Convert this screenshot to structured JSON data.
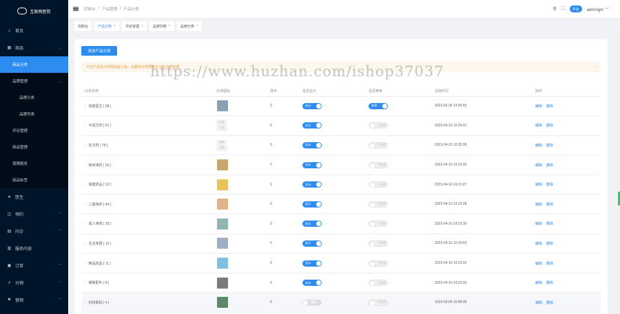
{
  "app": {
    "logo_text": "互联网医院"
  },
  "sidebar": {
    "items": [
      {
        "label": "首页",
        "icon": "home-icon"
      },
      {
        "label": "商品",
        "icon": "shop-icon",
        "expanded": true
      },
      {
        "label": "医生",
        "icon": "user-icon"
      },
      {
        "label": "预约",
        "icon": "calendar-icon"
      },
      {
        "label": "问诊",
        "icon": "chat-icon"
      },
      {
        "label": "服务内容",
        "icon": "service-icon"
      },
      {
        "label": "订单",
        "icon": "order-icon"
      },
      {
        "label": "分销",
        "icon": "share-icon"
      },
      {
        "label": "营销",
        "icon": "flag-icon"
      }
    ],
    "sub": {
      "product_category": "商品分类",
      "brand_mgmt": "品牌管理",
      "brand_category": "品牌分类",
      "brand_list": "品牌列表",
      "review_mgmt": "评论管理",
      "product_mgmt": "商品管理",
      "guarantee": "保障服务",
      "product_tags": "商品标签"
    }
  },
  "header": {
    "breadcrumb": [
      "控制台",
      "/",
      "产品管理",
      "/",
      "产品分类"
    ],
    "platform_badge": "平台",
    "username": "admingm"
  },
  "tabs": [
    {
      "label": "控制台",
      "closable": false,
      "active": false
    },
    {
      "label": "产品分类",
      "closable": true,
      "active": true
    },
    {
      "label": "评论管理",
      "closable": true,
      "active": false
    },
    {
      "label": "品牌列表",
      "closable": true,
      "active": false
    },
    {
      "label": "品牌分类",
      "closable": true,
      "active": false
    }
  ],
  "page": {
    "add_button": "添加产品分类",
    "alert_text": "平台产品的分类层级是三级，设置的分类层级可以在分类管理",
    "watermark": "https://www.huzhan.com/ishop37037",
    "columns": [
      "分类名称",
      "分类图标",
      "排序",
      "是否显示",
      "是否推荐",
      "创建时间",
      "操作"
    ],
    "rows": [
      {
        "name": "家庭医生 [ 88 ]",
        "icon_color": "#8aa0b5",
        "placeholder": false,
        "sort": "0",
        "show": "显示",
        "show_on": true,
        "rec": "推荐",
        "rec_on": true,
        "time": "2023-06-28 14:06:55"
      },
      {
        "name": "中成方药 [ 81 ]",
        "icon_color": "#e5e5e5",
        "placeholder": true,
        "sort": "0",
        "show": "显示",
        "show_on": true,
        "rec": "不推荐",
        "rec_on": false,
        "time": "2023-04-19 16:34:01"
      },
      {
        "name": "处方药 [ 78 ]",
        "icon_color": "#e5e5e5",
        "placeholder": true,
        "sort": "0",
        "show": "显示",
        "show_on": true,
        "rec": "不推荐",
        "rec_on": false,
        "time": "2023-04-15 10:35:08"
      },
      {
        "name": "随身用药 [ 56 ]",
        "icon_color": "#c9a66b",
        "placeholder": false,
        "sort": "0",
        "show": "显示",
        "show_on": true,
        "rec": "不推荐",
        "rec_on": false,
        "time": "2023-04-10 14:23:26"
      },
      {
        "name": "保健药品 [ 52 ]",
        "icon_color": "#e8c35a",
        "placeholder": false,
        "sort": "0",
        "show": "显示",
        "show_on": true,
        "rec": "不推荐",
        "rec_on": false,
        "time": "2023-04-10 14:23:27"
      },
      {
        "name": "儿童用药 [ 44 ]",
        "icon_color": "#e2b48a",
        "placeholder": false,
        "sort": "0",
        "show": "显示",
        "show_on": true,
        "rec": "不推荐",
        "rec_on": false,
        "time": "2023-04-10 14:23:28"
      },
      {
        "name": "成人用药 [ 35 ]",
        "icon_color": "#8db7b0",
        "placeholder": false,
        "sort": "0",
        "show": "显示",
        "show_on": true,
        "rec": "不推荐",
        "rec_on": false,
        "time": "2023-04-10 14:23:30"
      },
      {
        "name": "生活家居 [ 15 ]",
        "icon_color": "#9fb0c4",
        "placeholder": false,
        "sort": "0",
        "show": "显示",
        "show_on": true,
        "rec": "不推荐",
        "rec_on": false,
        "time": "2023-04-15 10:30:55"
      },
      {
        "name": "精品药品 [ 11 ]",
        "icon_color": "#7fc0e0",
        "placeholder": false,
        "sort": "0",
        "show": "显示",
        "show_on": true,
        "rec": "不推荐",
        "rec_on": false,
        "time": "2023-04-10 14:23:32"
      },
      {
        "name": "眼睛配件 [ 8 ]",
        "icon_color": "#7a7a7a",
        "placeholder": false,
        "sort": "0",
        "show": "显示",
        "show_on": true,
        "rec": "不推荐",
        "rec_on": false,
        "time": "2023-04-10 14:23:33"
      },
      {
        "name": "科技数码 [ 4 ]",
        "icon_color": "#5a8a6a",
        "placeholder": false,
        "sort": "0",
        "show": "隐藏",
        "show_on": false,
        "rec": "不推荐",
        "rec_on": false,
        "time": "2023-03-04 15:08:09"
      }
    ],
    "op_edit": "编辑",
    "op_delete": "删除",
    "placeholder_text": "加载\n失败"
  }
}
